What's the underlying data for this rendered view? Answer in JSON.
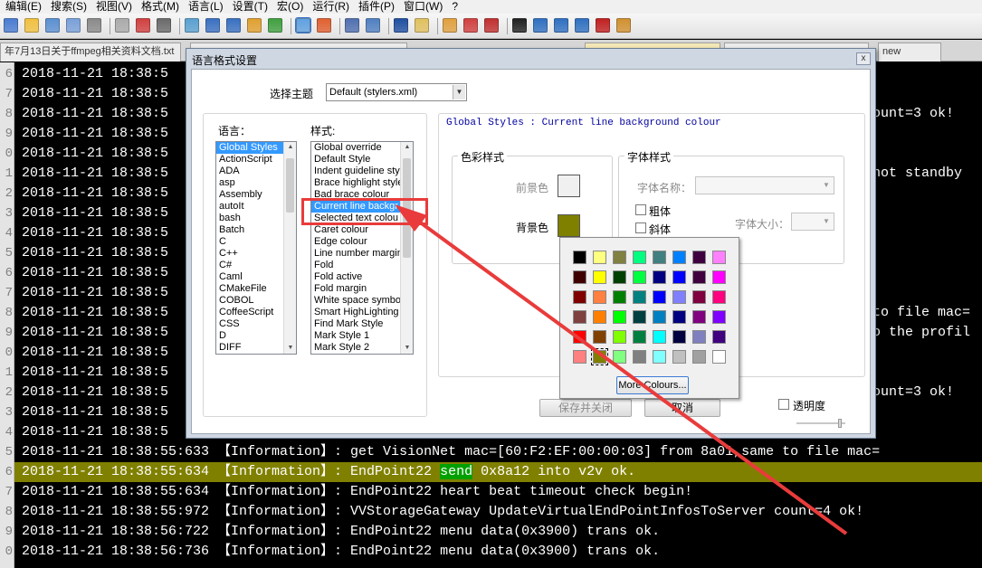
{
  "menubar": [
    "编辑(E)",
    "搜索(S)",
    "视图(V)",
    "格式(M)",
    "语言(L)",
    "设置(T)",
    "宏(O)",
    "运行(R)",
    "插件(P)",
    "窗口(W)",
    "?"
  ],
  "tabs": [
    {
      "label": "年7月13日关于ffmpeg相关资料文档.txt",
      "active": false
    },
    {
      "label": "",
      "active": false
    },
    {
      "label": "",
      "active": true
    },
    {
      "label": "",
      "active": false
    },
    {
      "label": "new",
      "active": false
    }
  ],
  "editor": {
    "line_numbers": [
      "6",
      "7",
      "8",
      "9",
      "0",
      "1",
      "2",
      "3",
      "4",
      "5",
      "6",
      "7",
      "8",
      "9",
      "0",
      "1",
      "2",
      "3",
      "4",
      "5",
      "6",
      "7",
      "8",
      "9",
      "0"
    ],
    "lines": [
      {
        "left": "2018-11-21 18:38:5",
        "right": ""
      },
      {
        "left": "2018-11-21 18:38:5",
        "right": ""
      },
      {
        "left": "2018-11-21 18:38:5",
        "right": "ount=3 ok!"
      },
      {
        "left": "2018-11-21 18:38:5",
        "right": ""
      },
      {
        "left": "2018-11-21 18:38:5",
        "right": ""
      },
      {
        "left": "2018-11-21 18:38:5",
        "right": "not standby"
      },
      {
        "left": "2018-11-21 18:38:5",
        "right": ""
      },
      {
        "left": "2018-11-21 18:38:5",
        "right": ""
      },
      {
        "left": "2018-11-21 18:38:5",
        "right": ""
      },
      {
        "left": "2018-11-21 18:38:5",
        "right": ""
      },
      {
        "left": "2018-11-21 18:38:5",
        "right": ""
      },
      {
        "left": "2018-11-21 18:38:5",
        "right": ""
      },
      {
        "left": "2018-11-21 18:38:5",
        "right": "to file mac="
      },
      {
        "left": "2018-11-21 18:38:5",
        "right": "o the profil"
      },
      {
        "left": "2018-11-21 18:38:5",
        "right": ""
      },
      {
        "left": "2018-11-21 18:38:5",
        "right": ""
      },
      {
        "left": "2018-11-21 18:38:5",
        "right": "ount=3 ok!"
      },
      {
        "left": "2018-11-21 18:38:5",
        "right": ""
      },
      {
        "left": "2018-11-21 18:38:5",
        "right": ""
      }
    ],
    "full_lines": [
      "2018-11-21 18:38:55:633 【Information】: get VisionNet mac=[60:F2:EF:00:00:03] from 8a01,same to file mac=",
      "2018-11-21 18:38:55:634 【Information】: EndPoint22 ",
      "2018-11-21 18:38:55:634 【Information】: EndPoint22 heart beat timeout check begin!",
      "2018-11-21 18:38:55:972 【Information】: VVStorageGateway UpdateVirtualEndPointInfosToServer count=4 ok!",
      "2018-11-21 18:38:56:722 【Information】: EndPoint22 menu data(0x3900) trans ok.",
      "2018-11-21 18:38:56:736 【Information】: EndPoint22 menu data(0x3900) trans ok."
    ],
    "current_line_highlight": "send",
    "current_line_rest": " 0x8a12 into v2v ok."
  },
  "dialog": {
    "title": "语言格式设置",
    "close": "x",
    "theme_label": "选择主题",
    "theme_value": "Default (stylers.xml)",
    "language_label": "语言：",
    "style_label": "样式:",
    "languages": [
      "Global Styles",
      "ActionScript",
      "ADA",
      "asp",
      "Assembly",
      "autoIt",
      "bash",
      "Batch",
      "C",
      "C++",
      "C#",
      "Caml",
      "CMakeFile",
      "COBOL",
      "CoffeeScript",
      "CSS",
      "D",
      "DIFF"
    ],
    "styles": [
      "Global override",
      "Default Style",
      "Indent guideline sty",
      "Brace highlight style",
      "Bad brace colour",
      "Current line backgr",
      "Selected text colou",
      "Caret colour",
      "Edge colour",
      "Line number margin",
      "Fold",
      "Fold active",
      "Fold margin",
      "White space symbo",
      "Smart HighLighting",
      "Find Mark Style",
      "Mark Style 1",
      "Mark Style 2"
    ],
    "selected_language_index": 0,
    "selected_style_index": 5,
    "description": "Global Styles : Current line background colour",
    "color_group": "色彩样式",
    "fg_label": "前景色",
    "bg_label": "背景色",
    "font_group": "字体样式",
    "font_name_label": "字体名称：",
    "bold_label": "粗体",
    "italic_label": "斜体",
    "font_size_label": "字体大小：",
    "save_close": "保存并关闭",
    "cancel": "取消",
    "transparency": "透明度"
  },
  "colors": {
    "bg_swatch": "#808000",
    "fg_swatch": "#f0f0f0",
    "current_line_bg": "#808000",
    "accent_red": "#e93b3b"
  },
  "color_popup": {
    "more_colours": "More Colours...",
    "grid": [
      [
        "#000000",
        "#ffff80",
        "#808040",
        "#00ff80",
        "#408080",
        "#0080ff",
        "#400040",
        "#ff80ff"
      ],
      [
        "#400000",
        "#ffff00",
        "#004000",
        "#00ff40",
        "#000080",
        "#0000ff",
        "#400040",
        "#ff00ff"
      ],
      [
        "#800000",
        "#ff8040",
        "#008000",
        "#008080",
        "#0000ff",
        "#8080ff",
        "#800040",
        "#ff0080"
      ],
      [
        "#804040",
        "#ff8000",
        "#00ff00",
        "#004040",
        "#0080c0",
        "#000080",
        "#800080",
        "#8000ff"
      ],
      [
        "#ff0000",
        "#804000",
        "#80ff00",
        "#008040",
        "#00ffff",
        "#000040",
        "#8080c0",
        "#400080"
      ],
      [
        "#ff8080",
        "#808000",
        "#80ff80",
        "#808080",
        "#80ffff",
        "#c0c0c0",
        "#a0a0a0",
        "#ffffff"
      ]
    ],
    "selected": [
      5,
      1
    ]
  }
}
